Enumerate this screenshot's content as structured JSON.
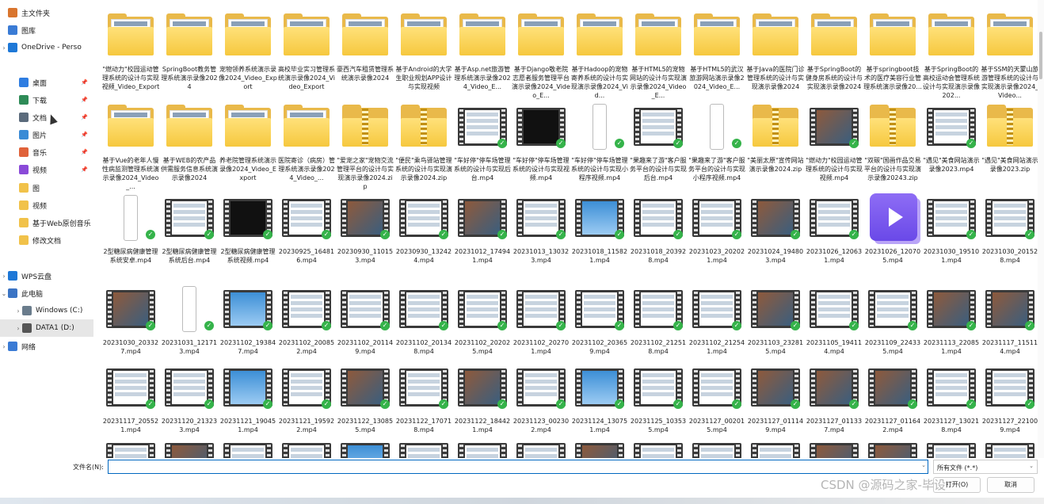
{
  "sidebar": {
    "items": [
      {
        "label": "主文件夹",
        "icon": "home-icon",
        "color": "#d9752e",
        "chevron": "",
        "pin": false
      },
      {
        "label": "图库",
        "icon": "gallery-icon",
        "color": "#3a7bd5",
        "chevron": "",
        "pin": false
      },
      {
        "label": "OneDrive - Perso",
        "icon": "onedrive-icon",
        "color": "#1e78d7",
        "chevron": "›",
        "pin": false
      },
      {
        "label": "桌面",
        "icon": "desktop-icon",
        "color": "#2f7de1",
        "chevron": "",
        "pin": true
      },
      {
        "label": "下载",
        "icon": "download-icon",
        "color": "#2e8b57",
        "chevron": "",
        "pin": true
      },
      {
        "label": "文档",
        "icon": "documents-icon",
        "color": "#5b6b7c",
        "chevron": "",
        "pin": true
      },
      {
        "label": "图片",
        "icon": "pictures-icon",
        "color": "#3a8bd6",
        "chevron": "",
        "pin": true
      },
      {
        "label": "音乐",
        "icon": "music-icon",
        "color": "#e0623a",
        "chevron": "",
        "pin": true
      },
      {
        "label": "视频",
        "icon": "videos-icon",
        "color": "#8a4ad8",
        "chevron": "",
        "pin": true
      },
      {
        "label": "图",
        "icon": "folder-icon",
        "color": "#f1c24a",
        "chevron": "",
        "pin": false
      },
      {
        "label": "视频",
        "icon": "folder-icon",
        "color": "#f1c24a",
        "chevron": "",
        "pin": false
      },
      {
        "label": "基于Web原创音乐",
        "icon": "folder-icon",
        "color": "#f1c24a",
        "chevron": "",
        "pin": false
      },
      {
        "label": "修改文档",
        "icon": "folder-icon",
        "color": "#f1c24a",
        "chevron": "",
        "pin": false
      },
      {
        "label": "WPS云盘",
        "icon": "wps-cloud-icon",
        "color": "#1e78d7",
        "chevron": "›",
        "pin": false
      },
      {
        "label": "此电脑",
        "icon": "this-pc-icon",
        "color": "#3b74c4",
        "chevron": "⌄",
        "pin": false
      },
      {
        "label": "Windows (C:)",
        "icon": "drive-c-icon",
        "color": "#6a7c8c",
        "chevron": "›",
        "pin": false
      },
      {
        "label": "DATA1 (D:)",
        "icon": "drive-d-icon",
        "color": "#555555",
        "chevron": "›",
        "pin": false
      },
      {
        "label": "网络",
        "icon": "network-icon",
        "color": "#3a7bd5",
        "chevron": "›",
        "pin": false
      }
    ]
  },
  "files": [
    {
      "name": "\"燃动力\"校园运动管理系统的设计与实现视频_Video_Export",
      "type": "folder"
    },
    {
      "name": "SpringBoot教务管理系统演示录像2024",
      "type": "folder"
    },
    {
      "name": "宠物领养系统演示录像2024_Video_Export",
      "type": "folder"
    },
    {
      "name": "高校毕业实习管理系统演示录像2024_Video_Export",
      "type": "folder"
    },
    {
      "name": "豪西汽车租赁管理系统演示录像2024",
      "type": "folder"
    },
    {
      "name": "基于Android的大学生职业规划APP设计与实现视频",
      "type": "folder"
    },
    {
      "name": "基于Asp.net旅游管理系统演示录像2024_Video_E...",
      "type": "folder"
    },
    {
      "name": "基于Django敬老院志愿者服务管理平台演示录像2024_Video_E...",
      "type": "folder"
    },
    {
      "name": "基于Hadoop的宠物寄养系统的设计与实现演示录像2024_Vid...",
      "type": "folder"
    },
    {
      "name": "基于HTML5的宠物网站的设计与实现演示录像2024_Video_E...",
      "type": "folder"
    },
    {
      "name": "基于HTML5的武汉旅游网站演示录像2024_Video_E...",
      "type": "folder"
    },
    {
      "name": "基于Java的医院门诊管理系统的设计与实现演示录像2024",
      "type": "folder"
    },
    {
      "name": "基于SpringBoot的健身房系统的设计与实现演示录像2024",
      "type": "folder"
    },
    {
      "name": "基于springboot技术的医疗美容行业管理系统演示录像20...",
      "type": "folder"
    },
    {
      "name": "基于SpringBoot的高校运动会管理系统设计与实现演示录像202...",
      "type": "folder"
    },
    {
      "name": "基于SSM的天蒙山旅游管理系统的设计与实现演示录像2024_Video...",
      "type": "folder"
    },
    {
      "name": "基于Vue的老年人慢性病监测管理系统演示录像2024_Video_...",
      "type": "folder"
    },
    {
      "name": "基于WEB的农产品供需服务信息系统演示录像2024",
      "type": "folder"
    },
    {
      "name": "养老院管理系统演示录像2024_Video_Export",
      "type": "folder"
    },
    {
      "name": "医院寄诊（病房）管理系统演示录像2024_Video_...",
      "type": "folder"
    },
    {
      "name": "\"爱宠之家\"宠物交流管理平台的设计与实现演示录像2024.zip",
      "type": "zip"
    },
    {
      "name": "\"便民\"乘鸟驿站管理系统的设计与实现演示录像2024.zip",
      "type": "zip"
    },
    {
      "name": "\"车好停\"停车场管理系统的设计与实现后台.mp4",
      "type": "video",
      "screen": "light"
    },
    {
      "name": "\"车好停\"停车场管理系统的设计与实现视频.mp4",
      "type": "video",
      "screen": "dark"
    },
    {
      "name": "\"车好停\"停车场管理系统的设计与实现小程序视频.mp4",
      "type": "phone"
    },
    {
      "name": "\"果趣来了游\"客户服务平台的设计与实现后台.mp4",
      "type": "video",
      "screen": "light"
    },
    {
      "name": "\"果趣来了游\"客户服务平台的设计与实现小程序视频.mp4",
      "type": "phone"
    },
    {
      "name": "\"美丽太原\"宣传网站演示录像2024.zip",
      "type": "zip"
    },
    {
      "name": "\"燃动力\"校园运动管理系统的设计与实现视频.mp4",
      "type": "video",
      "screen": "photo"
    },
    {
      "name": "\"双碳\"国画作品交易平台的设计与实现演示录像20243.zip",
      "type": "zip"
    },
    {
      "name": "\"遇见\"美食网站演示录像2023.mp4",
      "type": "video",
      "screen": "light"
    },
    {
      "name": "\"遇见\"美食网站演示录像2023.zip",
      "type": "zip"
    },
    {
      "name": "2型糖尿病健康管理系统安卓.mp4",
      "type": "phone"
    },
    {
      "name": "2型糖尿病健康管理系统后台.mp4",
      "type": "video",
      "screen": "light"
    },
    {
      "name": "2型糖尿病健康管理系统视频.mp4",
      "type": "video",
      "screen": "dark"
    },
    {
      "name": "20230925_164816.mp4",
      "type": "video",
      "screen": "light"
    },
    {
      "name": "20230930_110153.mp4",
      "type": "video",
      "screen": "photo"
    },
    {
      "name": "20230930_132424.mp4",
      "type": "video",
      "screen": "light"
    },
    {
      "name": "20231012_174941.mp4",
      "type": "video",
      "screen": "photo"
    },
    {
      "name": "20231013_130323.mp4",
      "type": "video",
      "screen": "light"
    },
    {
      "name": "20231018_115821.mp4",
      "type": "video",
      "screen": "blue"
    },
    {
      "name": "20231018_203928.mp4",
      "type": "video",
      "screen": "light"
    },
    {
      "name": "20231023_202021.mp4",
      "type": "video",
      "screen": "light"
    },
    {
      "name": "20231024_194803.mp4",
      "type": "video",
      "screen": "photo"
    },
    {
      "name": "20231026_120631.mp4",
      "type": "video",
      "screen": "light"
    },
    {
      "name": "20231026_120705.mp4",
      "type": "player"
    },
    {
      "name": "20231030_195101.mp4",
      "type": "video",
      "screen": "light"
    },
    {
      "name": "20231030_201528.mp4",
      "type": "video",
      "screen": "light"
    },
    {
      "name": "20231030_203327.mp4",
      "type": "video",
      "screen": "photo"
    },
    {
      "name": "20231031_121713.mp4",
      "type": "phone"
    },
    {
      "name": "20231102_193847.mp4",
      "type": "video",
      "screen": "blue"
    },
    {
      "name": "20231102_200852.mp4",
      "type": "video",
      "screen": "light"
    },
    {
      "name": "20231102_201149.mp4",
      "type": "video",
      "screen": "light"
    },
    {
      "name": "20231102_201348.mp4",
      "type": "video",
      "screen": "light"
    },
    {
      "name": "20231102_202025.mp4",
      "type": "video",
      "screen": "light"
    },
    {
      "name": "20231102_202701.mp4",
      "type": "video",
      "screen": "light"
    },
    {
      "name": "20231102_203659.mp4",
      "type": "video",
      "screen": "light"
    },
    {
      "name": "20231102_212518.mp4",
      "type": "video",
      "screen": "light"
    },
    {
      "name": "20231102_212541.mp4",
      "type": "video",
      "screen": "light"
    },
    {
      "name": "20231103_232815.mp4",
      "type": "video",
      "screen": "photo"
    },
    {
      "name": "20231105_194114.mp4",
      "type": "video",
      "screen": "light"
    },
    {
      "name": "20231109_224335.mp4",
      "type": "video",
      "screen": "light"
    },
    {
      "name": "20231113_220851.mp4",
      "type": "video",
      "screen": "photo"
    },
    {
      "name": "20231117_115114.mp4",
      "type": "video",
      "screen": "photo"
    },
    {
      "name": "20231117_205521.mp4",
      "type": "video",
      "screen": "light"
    },
    {
      "name": "20231120_213233.mp4",
      "type": "video",
      "screen": "light"
    },
    {
      "name": "20231121_190451.mp4",
      "type": "video",
      "screen": "blue"
    },
    {
      "name": "20231121_195922.mp4",
      "type": "video",
      "screen": "light"
    },
    {
      "name": "20231122_130855.mp4",
      "type": "video",
      "screen": "photo"
    },
    {
      "name": "20231122_170718.mp4",
      "type": "video",
      "screen": "light"
    },
    {
      "name": "20231122_184421.mp4",
      "type": "video",
      "screen": "photo"
    },
    {
      "name": "20231123_002302.mp4",
      "type": "video",
      "screen": "light"
    },
    {
      "name": "20231124_130751.mp4",
      "type": "video",
      "screen": "blue"
    },
    {
      "name": "20231125_103535.mp4",
      "type": "video",
      "screen": "light"
    },
    {
      "name": "20231127_002015.mp4",
      "type": "video",
      "screen": "light"
    },
    {
      "name": "20231127_011149.mp4",
      "type": "video",
      "screen": "photo"
    },
    {
      "name": "20231127_011337.mp4",
      "type": "video",
      "screen": "photo"
    },
    {
      "name": "20231127_011642.mp4",
      "type": "video",
      "screen": "photo"
    },
    {
      "name": "20231127_130218.mp4",
      "type": "video",
      "screen": "light"
    },
    {
      "name": "20231127_221009.mp4",
      "type": "video",
      "screen": "light"
    },
    {
      "name": "",
      "type": "video",
      "screen": "light"
    },
    {
      "name": "",
      "type": "video",
      "screen": "photo"
    },
    {
      "name": "",
      "type": "video",
      "screen": "light"
    },
    {
      "name": "",
      "type": "video",
      "screen": "light"
    },
    {
      "name": "",
      "type": "video",
      "screen": "blue"
    },
    {
      "name": "",
      "type": "video",
      "screen": "light"
    },
    {
      "name": "",
      "type": "video",
      "screen": "light"
    },
    {
      "name": "",
      "type": "video",
      "screen": "light"
    },
    {
      "name": "",
      "type": "video",
      "screen": "photo"
    },
    {
      "name": "",
      "type": "video",
      "screen": "light"
    },
    {
      "name": "",
      "type": "video",
      "screen": "light"
    },
    {
      "name": "",
      "type": "video",
      "screen": "light"
    },
    {
      "name": "",
      "type": "video",
      "screen": "photo"
    },
    {
      "name": "",
      "type": "video",
      "screen": "photo"
    },
    {
      "name": "",
      "type": "video",
      "screen": "light"
    },
    {
      "name": "",
      "type": "video",
      "screen": "light"
    }
  ],
  "bottom": {
    "filename_label": "文件名(N):",
    "filename_value": "",
    "filetype_label": "所有文件 (*.*)",
    "open_label": "打开(O)",
    "cancel_label": "取消"
  },
  "watermark": "CSDN @源码之家-毕设"
}
